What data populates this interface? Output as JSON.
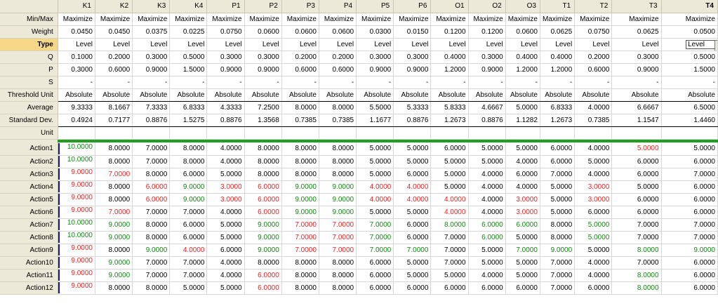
{
  "columns": [
    "K1",
    "K2",
    "K3",
    "K4",
    "P1",
    "P2",
    "P3",
    "P4",
    "P5",
    "P6",
    "O1",
    "O2",
    "O3",
    "T1",
    "T2",
    "T3",
    "T4"
  ],
  "rows": {
    "minmax": {
      "label": "Min/Max",
      "values": [
        "Maximize",
        "Maximize",
        "Maximize",
        "Maximize",
        "Maximize",
        "Maximize",
        "Maximize",
        "Maximize",
        "Maximize",
        "Maximize",
        "Maximize",
        "Maximize",
        "Maximize",
        "Maximize",
        "Maximize",
        "Maximize",
        "Maximize"
      ]
    },
    "weight": {
      "label": "Weight",
      "values": [
        "0.0450",
        "0.0450",
        "0.0375",
        "0.0225",
        "0.0750",
        "0.0600",
        "0.0600",
        "0.0600",
        "0.0300",
        "0.0150",
        "0.1200",
        "0.1200",
        "0.0600",
        "0.0625",
        "0.0750",
        "0.0625",
        "0.0500"
      ]
    },
    "type": {
      "label": "Type",
      "values": [
        "Level",
        "Level",
        "Level",
        "Level",
        "Level",
        "Level",
        "Level",
        "Level",
        "Level",
        "Level",
        "Level",
        "Level",
        "Level",
        "Level",
        "Level",
        "Level",
        "Level"
      ]
    },
    "q": {
      "label": "Q",
      "values": [
        "0.1000",
        "0.2000",
        "0.3000",
        "0.5000",
        "0.3000",
        "0.3000",
        "0.2000",
        "0.2000",
        "0.3000",
        "0.3000",
        "0.4000",
        "0.3000",
        "0.4000",
        "0.4000",
        "0.2000",
        "0.3000",
        "0.5000"
      ]
    },
    "p": {
      "label": "P",
      "values": [
        "0.3000",
        "0.6000",
        "0.9000",
        "1.5000",
        "0.9000",
        "0.9000",
        "0.6000",
        "0.6000",
        "0.9000",
        "0.9000",
        "1.2000",
        "0.9000",
        "1.2000",
        "1.2000",
        "0.6000",
        "0.9000",
        "1.5000"
      ]
    },
    "s": {
      "label": "S",
      "values": [
        "-",
        "-",
        "-",
        "-",
        "-",
        "-",
        "-",
        "-",
        "-",
        "-",
        "-",
        "-",
        "-",
        "-",
        "-",
        "-",
        "-"
      ]
    },
    "threshold": {
      "label": "Threshold Unit",
      "values": [
        "Absolute",
        "Absolute",
        "Absolute",
        "Absolute",
        "Absolute",
        "Absolute",
        "Absolute",
        "Absolute",
        "Absolute",
        "Absolute",
        "Absolute",
        "Absolute",
        "Absolute",
        "Absolute",
        "Absolute",
        "Absolute",
        "Absolute"
      ]
    },
    "average": {
      "label": "Average",
      "values": [
        "9.3333",
        "8.1667",
        "7.3333",
        "6.8333",
        "4.3333",
        "7.2500",
        "8.0000",
        "8.0000",
        "5.5000",
        "5.3333",
        "5.8333",
        "4.6667",
        "5.0000",
        "6.8333",
        "4.0000",
        "6.6667",
        "6.5000"
      ]
    },
    "stddev": {
      "label": "Standard Dev.",
      "values": [
        "0.4924",
        "0.7177",
        "0.8876",
        "1.5275",
        "0.8876",
        "1.3568",
        "0.7385",
        "0.7385",
        "1.1677",
        "0.8876",
        "1.2673",
        "0.8876",
        "1.1282",
        "1.2673",
        "0.7385",
        "1.1547",
        "1.4460"
      ]
    },
    "unit": {
      "label": "Unit",
      "values": [
        "",
        "",
        "",
        "",
        "",
        "",
        "",
        "",
        "",
        "",
        "",
        "",
        "",
        "",
        "",
        "",
        ""
      ]
    }
  },
  "actions": [
    {
      "label": "Action1",
      "values": [
        "10.0000",
        "8.0000",
        "7.0000",
        "8.0000",
        "4.0000",
        "8.0000",
        "8.0000",
        "8.0000",
        "5.0000",
        "5.0000",
        "6.0000",
        "5.0000",
        "5.0000",
        "6.0000",
        "4.0000",
        "5.0000",
        "5.0000"
      ],
      "colors": "gkkkkkkkkkkkkkkrk"
    },
    {
      "label": "Action2",
      "values": [
        "10.0000",
        "8.0000",
        "7.0000",
        "8.0000",
        "4.0000",
        "8.0000",
        "8.0000",
        "8.0000",
        "5.0000",
        "5.0000",
        "5.0000",
        "5.0000",
        "4.0000",
        "6.0000",
        "5.0000",
        "6.0000",
        "6.0000"
      ],
      "colors": "gkkkkkkkkkkkkkkkk"
    },
    {
      "label": "Action3",
      "values": [
        "9.0000",
        "7.0000",
        "8.0000",
        "6.0000",
        "5.0000",
        "8.0000",
        "8.0000",
        "8.0000",
        "5.0000",
        "6.0000",
        "5.0000",
        "4.0000",
        "6.0000",
        "7.0000",
        "4.0000",
        "6.0000",
        "7.0000"
      ],
      "colors": "rrkkkkkkkkkkkkkkk"
    },
    {
      "label": "Action4",
      "values": [
        "9.0000",
        "8.0000",
        "6.0000",
        "9.0000",
        "3.0000",
        "6.0000",
        "9.0000",
        "9.0000",
        "4.0000",
        "4.0000",
        "5.0000",
        "4.0000",
        "4.0000",
        "5.0000",
        "3.0000",
        "5.0000",
        "6.0000"
      ],
      "colors": "rkrgrrggrrkkkkrkk"
    },
    {
      "label": "Action5",
      "values": [
        "9.0000",
        "8.0000",
        "6.0000",
        "9.0000",
        "3.0000",
        "6.0000",
        "9.0000",
        "9.0000",
        "4.0000",
        "4.0000",
        "4.0000",
        "4.0000",
        "3.0000",
        "5.0000",
        "3.0000",
        "6.0000",
        "6.0000"
      ],
      "colors": "rkrgrrggrrrkrkrkk"
    },
    {
      "label": "Action6",
      "values": [
        "9.0000",
        "7.0000",
        "7.0000",
        "7.0000",
        "4.0000",
        "6.0000",
        "9.0000",
        "9.0000",
        "5.0000",
        "5.0000",
        "4.0000",
        "4.0000",
        "3.0000",
        "5.0000",
        "6.0000",
        "6.0000",
        "6.0000"
      ],
      "colors": "rrkkkrggkkrkrkkkk"
    },
    {
      "label": "Action7",
      "values": [
        "10.0000",
        "9.0000",
        "8.0000",
        "6.0000",
        "5.0000",
        "9.0000",
        "7.0000",
        "7.0000",
        "7.0000",
        "6.0000",
        "8.0000",
        "6.0000",
        "6.0000",
        "8.0000",
        "5.0000",
        "7.0000",
        "7.0000"
      ],
      "colors": "ggkkkgrrgkgggkgkk"
    },
    {
      "label": "Action8",
      "values": [
        "10.0000",
        "9.0000",
        "8.0000",
        "6.0000",
        "5.0000",
        "9.0000",
        "7.0000",
        "7.0000",
        "7.0000",
        "6.0000",
        "7.0000",
        "6.0000",
        "5.0000",
        "8.0000",
        "5.0000",
        "7.0000",
        "7.0000"
      ],
      "colors": "ggkkkgrrgkkgkkgkk"
    },
    {
      "label": "Action9",
      "values": [
        "9.0000",
        "8.0000",
        "9.0000",
        "4.0000",
        "6.0000",
        "9.0000",
        "7.0000",
        "7.0000",
        "7.0000",
        "7.0000",
        "7.0000",
        "5.0000",
        "7.0000",
        "9.0000",
        "5.0000",
        "8.0000",
        "9.0000"
      ],
      "colors": "rkgrkgrrggkkggkgg"
    },
    {
      "label": "Action10",
      "values": [
        "9.0000",
        "9.0000",
        "7.0000",
        "7.0000",
        "4.0000",
        "8.0000",
        "8.0000",
        "8.0000",
        "6.0000",
        "5.0000",
        "7.0000",
        "5.0000",
        "5.0000",
        "7.0000",
        "4.0000",
        "7.0000",
        "6.0000"
      ],
      "colors": "rgkkkkkkkkkkkkkkk"
    },
    {
      "label": "Action11",
      "values": [
        "9.0000",
        "9.0000",
        "7.0000",
        "7.0000",
        "4.0000",
        "6.0000",
        "8.0000",
        "8.0000",
        "6.0000",
        "5.0000",
        "5.0000",
        "4.0000",
        "5.0000",
        "7.0000",
        "4.0000",
        "8.0000",
        "6.0000"
      ],
      "colors": "rgkkkrkkkkkkkkkgk"
    },
    {
      "label": "Action12",
      "values": [
        "9.0000",
        "8.0000",
        "8.0000",
        "5.0000",
        "5.0000",
        "6.0000",
        "8.0000",
        "8.0000",
        "6.0000",
        "6.0000",
        "6.0000",
        "6.0000",
        "6.0000",
        "7.0000",
        "6.0000",
        "8.0000",
        "6.0000"
      ],
      "colors": "rkkkkrkkkkkkkkkgk"
    }
  ],
  "colors": {
    "green_bar": "#1ea01e",
    "marker": "#1010c8",
    "header_bg": "#ece9d8",
    "positive": "#118811",
    "negative": "#ee2222"
  },
  "icons": {
    "dropdown": "chevron-down-icon"
  }
}
